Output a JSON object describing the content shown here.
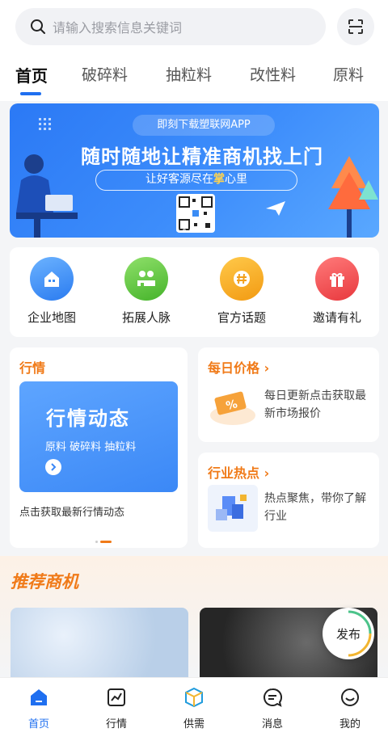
{
  "search": {
    "placeholder": "请输入搜索信息关键词",
    "icon": "search-icon",
    "scan_icon": "scan-icon"
  },
  "tabs": [
    {
      "label": "首页",
      "active": true
    },
    {
      "label": "破碎料",
      "active": false
    },
    {
      "label": "抽粒料",
      "active": false
    },
    {
      "label": "改性料",
      "active": false
    },
    {
      "label": "原料",
      "active": false
    }
  ],
  "banner": {
    "pill": "即刻下载塑联网APP",
    "headline": "随时随地让精准商机找上门",
    "sub_before": "让好客源尽在",
    "sub_highlight": "掌",
    "sub_after": "心里"
  },
  "quick": [
    {
      "label": "企业地图",
      "icon": "building-icon",
      "color": "#3a8cf5"
    },
    {
      "label": "拓展人脉",
      "icon": "people-icon",
      "color": "#5cc23a"
    },
    {
      "label": "官方话题",
      "icon": "hashtag-icon",
      "color": "#f5a41c"
    },
    {
      "label": "邀请有礼",
      "icon": "gift-icon",
      "color": "#f0474b"
    }
  ],
  "market": {
    "title": "行情",
    "box_title": "行情动态",
    "box_tags": "原料  破碎料  抽粒料",
    "desc": "点击获取最新行情动态"
  },
  "daily_price": {
    "title": "每日价格 ›",
    "desc": "每日更新点击获取最新市场报价",
    "icon": "discount-coupon-icon"
  },
  "hot": {
    "title": "行业热点 ›",
    "desc": "热点聚焦，带你了解行业",
    "icon": "cubes-icon"
  },
  "recommend": {
    "title": "推荐商机"
  },
  "publish": {
    "label": "发布"
  },
  "bottom_nav": [
    {
      "label": "首页",
      "icon": "home-icon",
      "active": true
    },
    {
      "label": "行情",
      "icon": "chart-icon",
      "active": false
    },
    {
      "label": "供需",
      "icon": "box-icon",
      "active": false
    },
    {
      "label": "消息",
      "icon": "message-icon",
      "active": false
    },
    {
      "label": "我的",
      "icon": "smile-face-icon",
      "active": false
    }
  ],
  "colors": {
    "accent": "#1f6ff0",
    "orange": "#f07a18"
  }
}
